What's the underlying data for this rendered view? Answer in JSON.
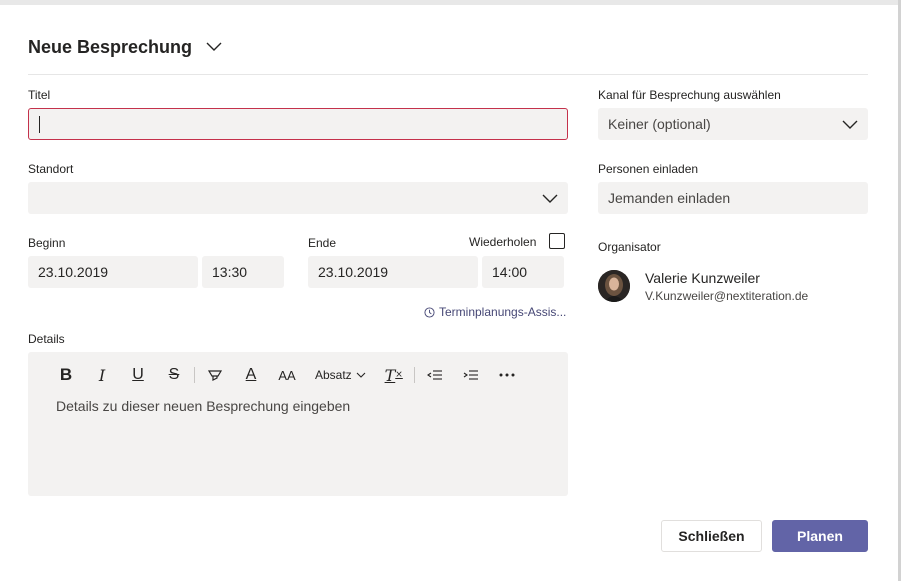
{
  "header": {
    "title": "Neue Besprechung"
  },
  "form": {
    "title_label": "Titel",
    "title_value": "",
    "location_label": "Standort",
    "location_value": "",
    "start_label": "Beginn",
    "start_date": "23.10.2019",
    "start_time": "13:30",
    "end_label": "Ende",
    "end_date": "23.10.2019",
    "end_time": "14:00",
    "repeat_label": "Wiederholen",
    "scheduling_link": "Terminplanungs-Assis...",
    "details_label": "Details",
    "details_placeholder": "Details zu dieser neuen Besprechung eingeben"
  },
  "toolbar": {
    "bold": "B",
    "italic": "I",
    "underline": "U",
    "strike": "S",
    "font_color": "A",
    "font_size": "AA",
    "paragraph": "Absatz",
    "clear_format": "T"
  },
  "sidebar": {
    "channel_label": "Kanal für Besprechung auswählen",
    "channel_value": "Keiner (optional)",
    "invite_label": "Personen einladen",
    "invite_placeholder": "Jemanden einladen",
    "organizer_label": "Organisator",
    "organizer_name": "Valerie Kunzweiler",
    "organizer_email": "V.Kunzweiler@nextiteration.de"
  },
  "buttons": {
    "close": "Schließen",
    "plan": "Planen"
  },
  "colors": {
    "accent": "#6264a7",
    "error_border": "#c4314b",
    "field_bg": "#f3f2f1"
  }
}
